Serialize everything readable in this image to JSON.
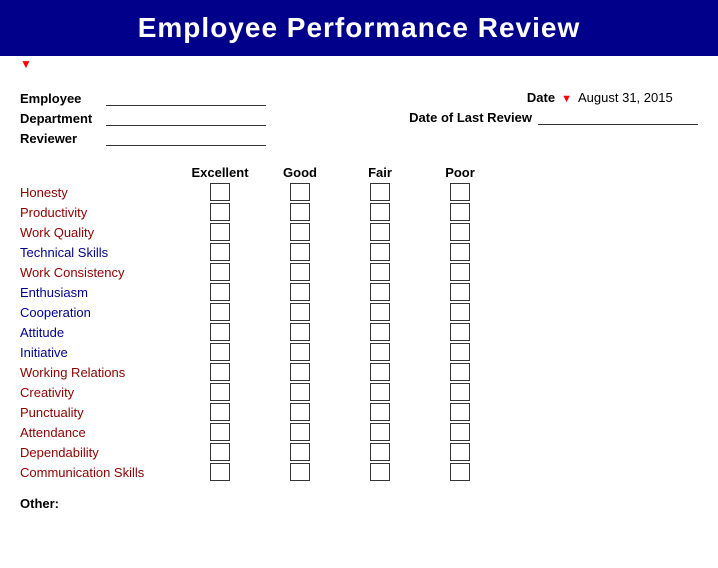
{
  "header": {
    "title": "Employee Performance Review"
  },
  "form": {
    "employee_label": "Employee",
    "department_label": "Department",
    "reviewer_label": "Reviewer",
    "date_label": "Date",
    "date_indicator": "▼",
    "date_value": "August 31, 2015",
    "last_review_label": "Date of Last Review"
  },
  "ratings": {
    "columns": [
      "Excellent",
      "Good",
      "Fair",
      "Poor"
    ],
    "skills": [
      {
        "name": "Honesty",
        "color": "dark-red"
      },
      {
        "name": "Productivity",
        "color": "dark-red"
      },
      {
        "name": "Work Quality",
        "color": "dark-red"
      },
      {
        "name": "Technical Skills",
        "color": "blue"
      },
      {
        "name": "Work Consistency",
        "color": "dark-red"
      },
      {
        "name": "Enthusiasm",
        "color": "blue"
      },
      {
        "name": "Cooperation",
        "color": "blue"
      },
      {
        "name": "Attitude",
        "color": "blue"
      },
      {
        "name": "Initiative",
        "color": "blue"
      },
      {
        "name": "Working Relations",
        "color": "dark-red"
      },
      {
        "name": "Creativity",
        "color": "dark-red"
      },
      {
        "name": "Punctuality",
        "color": "dark-red"
      },
      {
        "name": "Attendance",
        "color": "dark-red"
      },
      {
        "name": "Dependability",
        "color": "dark-red"
      },
      {
        "name": "Communication Skills",
        "color": "dark-red"
      }
    ]
  },
  "other_label": "Other:"
}
